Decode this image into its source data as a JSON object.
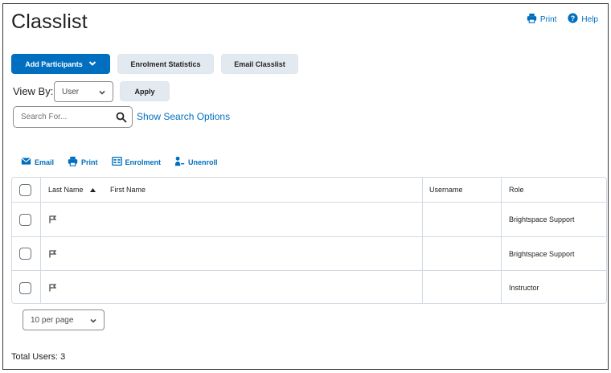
{
  "page": {
    "title": "Classlist"
  },
  "top_links": {
    "print": "Print",
    "help": "Help"
  },
  "toolbar": {
    "add_participants": "Add Participants",
    "enrolment_statistics": "Enrolment Statistics",
    "email_classlist": "Email Classlist",
    "apply": "Apply"
  },
  "view_by": {
    "label": "View By:",
    "selected": "User"
  },
  "search": {
    "placeholder": "Search For...",
    "value": "",
    "show_options": "Show Search Options"
  },
  "actions": {
    "email": "Email",
    "print": "Print",
    "enrolment": "Enrolment",
    "unenroll": "Unenroll"
  },
  "table": {
    "headers": {
      "last_name": "Last Name",
      "first_name": "First Name",
      "username": "Username",
      "role": "Role"
    },
    "rows": [
      {
        "last_name": "",
        "first_name": "",
        "username": "",
        "role": "Brightspace Support"
      },
      {
        "last_name": "",
        "first_name": "",
        "username": "",
        "role": "Brightspace Support"
      },
      {
        "last_name": "",
        "first_name": "",
        "username": "",
        "role": "Instructor"
      }
    ]
  },
  "pagination": {
    "per_page": "10 per page"
  },
  "footer": {
    "total_users": "Total Users: 3"
  },
  "colors": {
    "accent": "#006fbf",
    "secondary_button": "#e3e9f1",
    "border": "#d3d9e3"
  }
}
